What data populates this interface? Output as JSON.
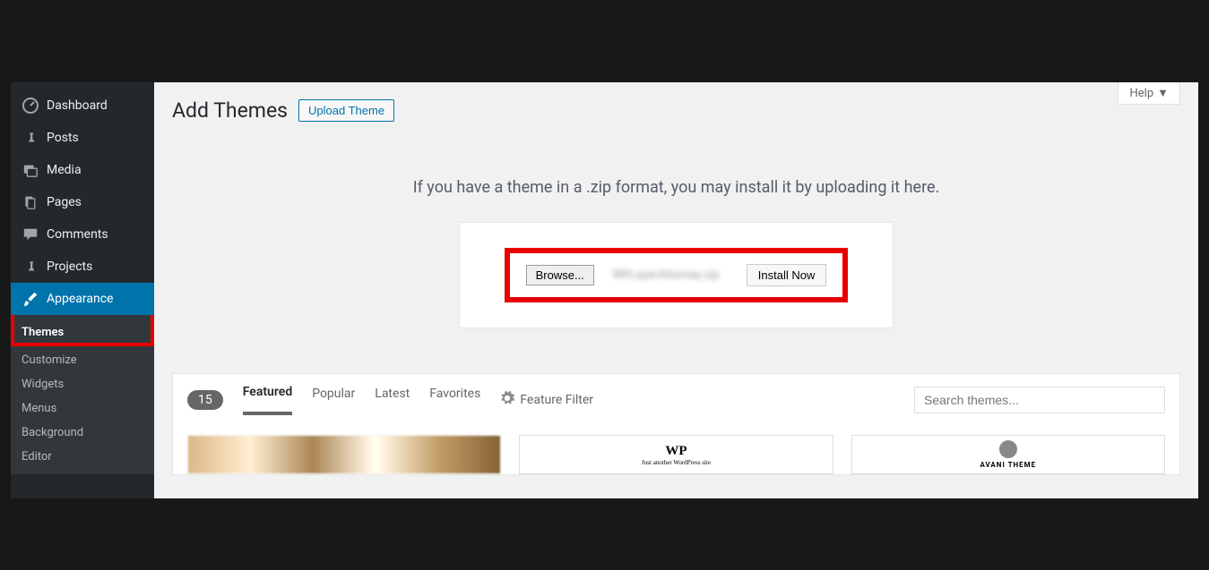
{
  "sidebar": {
    "items": [
      {
        "label": "Dashboard"
      },
      {
        "label": "Posts"
      },
      {
        "label": "Media"
      },
      {
        "label": "Pages"
      },
      {
        "label": "Comments"
      },
      {
        "label": "Projects"
      },
      {
        "label": "Appearance"
      }
    ],
    "appearance_submenu": [
      {
        "label": "Themes"
      },
      {
        "label": "Customize"
      },
      {
        "label": "Widgets"
      },
      {
        "label": "Menus"
      },
      {
        "label": "Background"
      },
      {
        "label": "Editor"
      }
    ]
  },
  "help": {
    "label": "Help"
  },
  "header": {
    "title": "Add Themes",
    "upload_button": "Upload Theme"
  },
  "upload": {
    "description": "If you have a theme in a .zip format, you may install it by uploading it here.",
    "browse": "Browse...",
    "filename": "WPLayerAttorney.zip",
    "install": "Install Now"
  },
  "filter": {
    "count": "15",
    "tabs": {
      "featured": "Featured",
      "popular": "Popular",
      "latest": "Latest",
      "favorites": "Favorites"
    },
    "feature_filter": "Feature Filter",
    "search_placeholder": "Search themes..."
  },
  "themes": {
    "card2": {
      "logo": "WP",
      "tagline": "Just another WordPress site"
    },
    "card3": {
      "name": "AVANI THEME"
    }
  }
}
